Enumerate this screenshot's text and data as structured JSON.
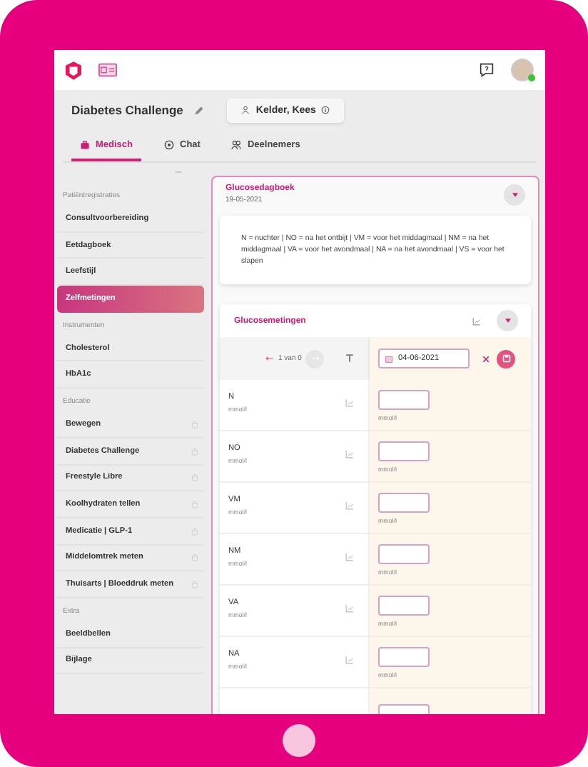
{
  "header": {
    "title": "Diabetes Challenge",
    "patient": "Kelder, Kees"
  },
  "tabs": [
    {
      "label": "Medisch",
      "selected": true
    },
    {
      "label": "Chat",
      "selected": false
    },
    {
      "label": "Deelnemers",
      "selected": false
    }
  ],
  "sidebar": {
    "sections": [
      {
        "heading": "Patiëntregistraties",
        "items": [
          {
            "label": "Consultvoorbereiding",
            "selected": false,
            "locked": false
          },
          {
            "label": "Eetdagboek",
            "selected": false,
            "locked": false
          },
          {
            "label": "Leefstijl",
            "selected": false,
            "locked": false
          },
          {
            "label": "Zelfmetingen",
            "selected": true,
            "locked": false
          }
        ]
      },
      {
        "heading": "Instrumenten",
        "items": [
          {
            "label": "Cholesterol",
            "selected": false,
            "locked": false
          },
          {
            "label": "HbA1c",
            "selected": false,
            "locked": false
          }
        ]
      },
      {
        "heading": "Educatie",
        "items": [
          {
            "label": "Bewegen",
            "selected": false,
            "locked": true
          },
          {
            "label": "Diabetes Challenge",
            "selected": false,
            "locked": true
          },
          {
            "label": "Freestyle Libre",
            "selected": false,
            "locked": true
          },
          {
            "label": "Koolhydraten tellen",
            "selected": false,
            "locked": true
          },
          {
            "label": "Medicatie | GLP-1",
            "selected": false,
            "locked": true
          },
          {
            "label": "Middelomtrek meten",
            "selected": false,
            "locked": true
          },
          {
            "label": "Thuisarts | Bloeddruk meten",
            "selected": false,
            "locked": true
          }
        ]
      },
      {
        "heading": "Extra",
        "items": [
          {
            "label": "Beeldbellen",
            "selected": false,
            "locked": false
          },
          {
            "label": "Bijlage",
            "selected": false,
            "locked": false
          }
        ]
      }
    ]
  },
  "diary": {
    "title": "Glucosedagboek",
    "date": "19-05-2021",
    "legend": "N = nuchter | NO = na het ontbijt | VM = voor het middagmaal | NM = na het middagmaal | VA = voor het avondmaal | NA = na het avondmaal | VS = voor het slapen"
  },
  "measurements": {
    "title": "Glucosemetingen",
    "pager": "1 van 0",
    "date": "04-06-2021",
    "rows": [
      {
        "label": "N",
        "unit": "mmol/l",
        "input_unit": "mmol/l"
      },
      {
        "label": "NO",
        "unit": "mmol/l",
        "input_unit": "mmol/l"
      },
      {
        "label": "VM",
        "unit": "mmol/l",
        "input_unit": "mmol/l"
      },
      {
        "label": "NM",
        "unit": "mmol/l",
        "input_unit": "mmol/l"
      },
      {
        "label": "VA",
        "unit": "mmol/l",
        "input_unit": "mmol/l"
      },
      {
        "label": "NA",
        "unit": "mmol/l",
        "input_unit": "mmol/l"
      }
    ]
  }
}
